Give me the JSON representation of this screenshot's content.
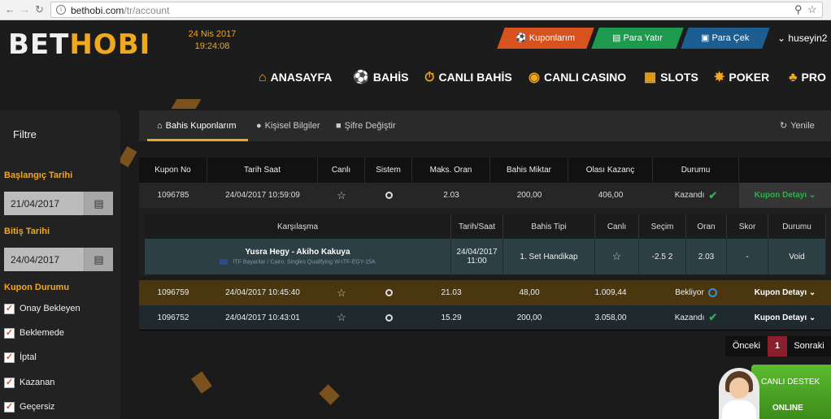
{
  "browser": {
    "url_host": "bethobi.com",
    "url_path": "/tr/account"
  },
  "header": {
    "logo_a": "BET",
    "logo_b": "HOBI",
    "date": "24 Nis 2017",
    "time": "19:24:08",
    "kupon_btn": "Kuponlarım",
    "yatir_btn": "Para Yatır",
    "cek_btn": "Para Çek",
    "username": "huseyin2"
  },
  "nav": [
    "ANASAYFA",
    "BAHİS",
    "CANLI BAHİS",
    "CANLI CASINO",
    "SLOTS",
    "POKER",
    "PRO"
  ],
  "sidebar": {
    "title": "Filtre",
    "start_label": "Başlangıç Tarihi",
    "start_value": "21/04/2017",
    "end_label": "Bitiş Tarihi",
    "end_value": "24/04/2017",
    "status_label": "Kupon Durumu",
    "statuses": [
      "Onay Bekleyen",
      "Beklemede",
      "İptal",
      "Kazanan",
      "Geçersiz"
    ]
  },
  "tabs": {
    "kupon": "Bahis Kuponlarım",
    "bilgi": "Kişisel Bilgiler",
    "sifre": "Şifre Değiştir",
    "yenile": "Yenile"
  },
  "table": {
    "headers": [
      "Kupon No",
      "Tarih Saat",
      "Canlı",
      "Sistem",
      "Maks. Oran",
      "Bahis Miktar",
      "Olası Kazanç",
      "Durumu"
    ],
    "rows": [
      {
        "no": "1096785",
        "date": "24/04/2017 10:59:09",
        "oran": "2.03",
        "miktar": "200,00",
        "kazanc": "406,00",
        "durum": "Kazandı",
        "detay": "Kupon Detayı"
      },
      {
        "no": "1096759",
        "date": "24/04/2017 10:45:40",
        "oran": "21.03",
        "miktar": "48,00",
        "kazanc": "1.009,44",
        "durum": "Bekliyor",
        "detay": "Kupon Detayı"
      },
      {
        "no": "1096752",
        "date": "24/04/2017 10:43:01",
        "oran": "15.29",
        "miktar": "200,00",
        "kazanc": "3.058,00",
        "durum": "Kazandı",
        "detay": "Kupon Detayı"
      }
    ],
    "detail_headers": [
      "Karşılaşma",
      "Tarih/Saat",
      "Bahis Tipi",
      "Canlı",
      "Seçim",
      "Oran",
      "Skor",
      "Durumu"
    ],
    "detail": {
      "match": "Yusra Hegy - Akiho Kakuya",
      "league": "ITF Bayanlar / Cairo, Singles Qualifying W-ITF-EGY-15A",
      "date": "24/04/2017",
      "time": "11:00",
      "tip": "1. Set Handikap",
      "secim": "-2.5 2",
      "oran": "2.03",
      "skor": "-",
      "durum": "Void"
    }
  },
  "pager": {
    "prev": "Önceki",
    "page": "1",
    "next": "Sonraki"
  },
  "support": {
    "line1": "CANLI DESTEK",
    "line2": "ONLINE"
  }
}
